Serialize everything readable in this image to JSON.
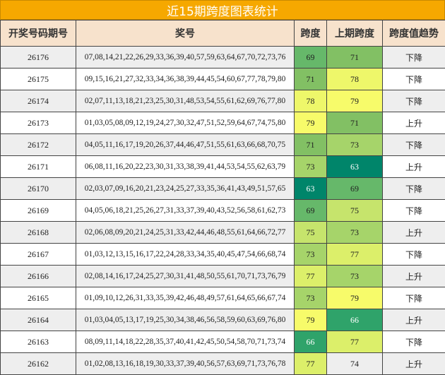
{
  "title": "近15期跨度图表统计",
  "headers": [
    "开奖号码期号",
    "奖号",
    "跨度",
    "上期跨度",
    "跨度值趋势"
  ],
  "colors": {
    "63": "#00856a",
    "66": "#2fa36a",
    "69": "#66b86a",
    "71": "#82c064",
    "73": "#a6d46a",
    "75": "#c6e46c",
    "77": "#dcef6a",
    "78": "#eef76a",
    "79": "#f7fb6a"
  },
  "rows": [
    {
      "issue": "26176",
      "numbers": "07,08,14,21,22,26,29,33,36,39,40,57,59,63,64,67,70,72,73,76",
      "span": "69",
      "prev": "71",
      "trend": "下降"
    },
    {
      "issue": "26175",
      "numbers": "09,15,16,21,27,32,33,34,36,38,39,44,45,54,60,67,77,78,79,80",
      "span": "71",
      "prev": "78",
      "trend": "下降"
    },
    {
      "issue": "26174",
      "numbers": "02,07,11,13,18,21,23,25,30,31,48,53,54,55,61,62,69,76,77,80",
      "span": "78",
      "prev": "79",
      "trend": "下降"
    },
    {
      "issue": "26173",
      "numbers": "01,03,05,08,09,12,19,24,27,30,32,47,51,52,59,64,67,74,75,80",
      "span": "79",
      "prev": "71",
      "trend": "上升"
    },
    {
      "issue": "26172",
      "numbers": "04,05,11,16,17,19,20,26,37,44,46,47,51,55,61,63,66,68,70,75",
      "span": "71",
      "prev": "73",
      "trend": "下降"
    },
    {
      "issue": "26171",
      "numbers": "06,08,11,16,20,22,23,30,31,33,38,39,41,44,53,54,55,62,63,79",
      "span": "73",
      "prev": "63",
      "trend": "上升"
    },
    {
      "issue": "26170",
      "numbers": "02,03,07,09,16,20,21,23,24,25,27,33,35,36,41,43,49,51,57,65",
      "span": "63",
      "prev": "69",
      "trend": "下降"
    },
    {
      "issue": "26169",
      "numbers": "04,05,06,18,21,25,26,27,31,33,37,39,40,43,52,56,58,61,62,73",
      "span": "69",
      "prev": "75",
      "trend": "下降"
    },
    {
      "issue": "26168",
      "numbers": "02,06,08,09,20,21,24,25,31,33,42,44,46,48,55,61,64,66,72,77",
      "span": "75",
      "prev": "73",
      "trend": "上升"
    },
    {
      "issue": "26167",
      "numbers": "01,03,12,13,15,16,17,22,24,28,33,34,35,40,45,47,54,66,68,74",
      "span": "73",
      "prev": "77",
      "trend": "下降"
    },
    {
      "issue": "26166",
      "numbers": "02,08,14,16,17,24,25,27,30,31,41,48,50,55,61,70,71,73,76,79",
      "span": "77",
      "prev": "73",
      "trend": "上升"
    },
    {
      "issue": "26165",
      "numbers": "01,09,10,12,26,31,33,35,39,42,46,48,49,57,61,64,65,66,67,74",
      "span": "73",
      "prev": "79",
      "trend": "下降"
    },
    {
      "issue": "26164",
      "numbers": "01,03,04,05,13,17,19,25,30,34,38,46,56,58,59,60,63,69,76,80",
      "span": "79",
      "prev": "66",
      "trend": "上升"
    },
    {
      "issue": "26163",
      "numbers": "08,09,11,14,18,22,28,35,37,40,41,42,45,50,54,58,70,71,73,74",
      "span": "66",
      "prev": "77",
      "trend": "下降"
    },
    {
      "issue": "26162",
      "numbers": "01,02,08,13,16,18,19,30,33,37,39,40,56,57,63,69,71,73,76,78",
      "span": "77",
      "prev": "74",
      "trend": "上升"
    }
  ]
}
